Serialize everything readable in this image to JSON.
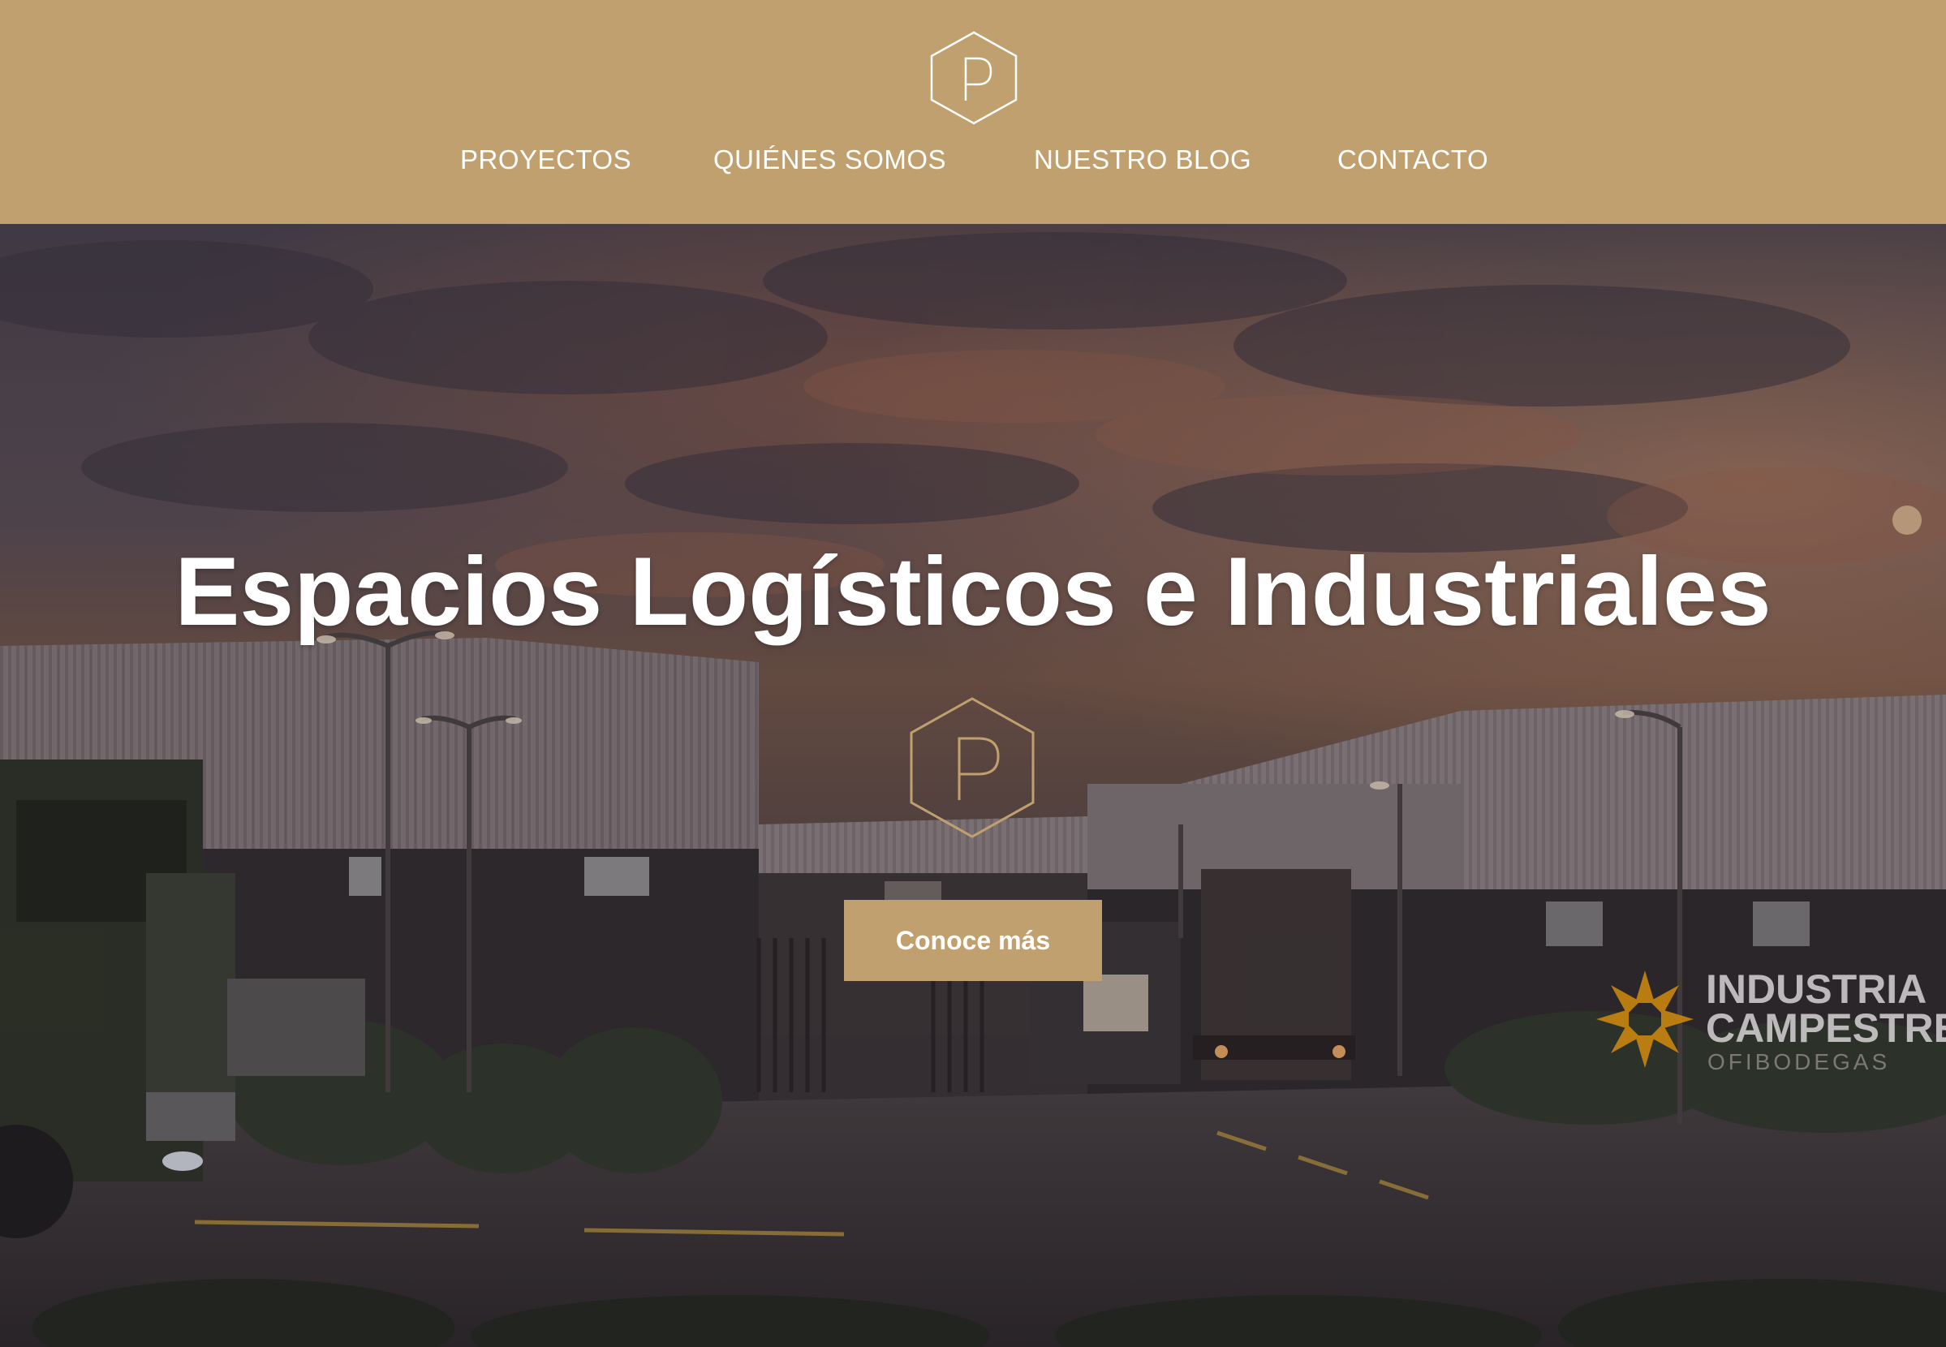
{
  "header": {
    "logo_icon": "p-hexagon-logo",
    "background_color": "#c1a06f"
  },
  "nav": {
    "items": [
      {
        "label": "PROYECTOS"
      },
      {
        "label": "QUIÉNES SOMOS"
      },
      {
        "label": "NUESTRO BLOG"
      },
      {
        "label": "CONTACTO"
      }
    ]
  },
  "hero": {
    "title": "Espacios Logísticos e Industriales",
    "logo_icon": "p-hexagon-logo",
    "cta_label": "Conoce más",
    "accent_color": "#c1a06f",
    "sign": {
      "line1": "INDUSTRIA",
      "line2": "CAMPESTRE",
      "line3": "OFIBODEGAS"
    }
  }
}
